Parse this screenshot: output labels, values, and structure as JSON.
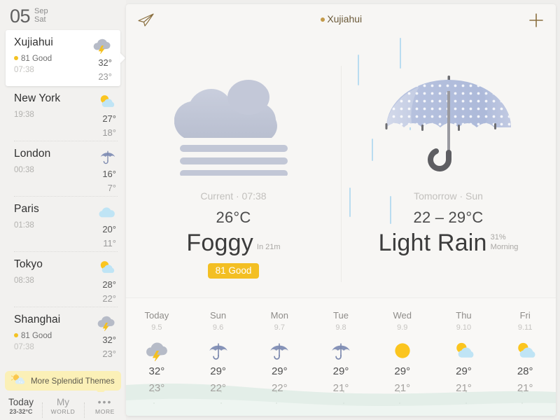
{
  "sidebar": {
    "date": {
      "day": "05",
      "month": "Sep",
      "weekday": "Sat"
    },
    "cities": [
      {
        "name": "Xujiahui",
        "aqi": "81 Good",
        "time": "07:38",
        "high": "32°",
        "low": "23°",
        "icon": "thunder-cloud-icon",
        "selected": true
      },
      {
        "name": "New York",
        "aqi": "",
        "time": "19:38",
        "high": "27°",
        "low": "18°",
        "icon": "sun-cloud-icon",
        "selected": false
      },
      {
        "name": "London",
        "aqi": "",
        "time": "00:38",
        "high": "16°",
        "low": "7°",
        "icon": "umbrella-icon",
        "selected": false
      },
      {
        "name": "Paris",
        "aqi": "",
        "time": "01:38",
        "high": "20°",
        "low": "11°",
        "icon": "cloud-icon",
        "selected": false
      },
      {
        "name": "Tokyo",
        "aqi": "",
        "time": "08:38",
        "high": "28°",
        "low": "22°",
        "icon": "sun-cloud-icon",
        "selected": false
      },
      {
        "name": "Shanghai",
        "aqi": "81 Good",
        "time": "07:38",
        "high": "32°",
        "low": "23°",
        "icon": "thunder-cloud-icon",
        "selected": false
      }
    ],
    "themes_button": "More Splendid Themes",
    "nav": [
      {
        "primary": "Today",
        "secondary": "23-32°C",
        "active": true
      },
      {
        "primary": "My",
        "secondary": "WORLD",
        "active": false
      },
      {
        "primary": "•••",
        "secondary": "MORE",
        "active": false
      }
    ]
  },
  "header": {
    "title": "Xujiahui",
    "share_icon": "paper-plane-icon",
    "add_icon": "plus-icon",
    "location_icon": "location-pin-icon"
  },
  "current": {
    "when": "Current · 07:38",
    "temperature": "26°C",
    "condition": "Foggy",
    "note": "In 21m",
    "aqi_badge": "81 Good",
    "icon": "fog-icon"
  },
  "tomorrow": {
    "when": "Tomorrow · Sun",
    "temperature": "22 – 29°C",
    "condition": "Light Rain",
    "note_pct": "31%",
    "note_time": "Morning",
    "icon": "umbrella-icon"
  },
  "forecast": [
    {
      "day": "Today",
      "date": "9.5",
      "icon": "thunder-cloud-icon",
      "high": "32°",
      "low": "23°"
    },
    {
      "day": "Sun",
      "date": "9.6",
      "icon": "umbrella-icon",
      "high": "29°",
      "low": "22°"
    },
    {
      "day": "Mon",
      "date": "9.7",
      "icon": "umbrella-icon",
      "high": "29°",
      "low": "22°"
    },
    {
      "day": "Tue",
      "date": "9.8",
      "icon": "umbrella-icon",
      "high": "29°",
      "low": "21°"
    },
    {
      "day": "Wed",
      "date": "9.9",
      "icon": "sun-icon",
      "high": "29°",
      "low": "21°"
    },
    {
      "day": "Thu",
      "date": "9.10",
      "icon": "sun-cloud-icon",
      "high": "29°",
      "low": "21°"
    },
    {
      "day": "Fri",
      "date": "9.11",
      "icon": "sun-cloud-icon",
      "high": "28°",
      "low": "21°"
    }
  ],
  "colors": {
    "accent_yellow": "#f3bf23",
    "theme_pill": "#fbf0b7",
    "title_brown": "#6b5a39",
    "rain_blue": "#b9dcf0",
    "panel_bg": "#f7f6f4",
    "sidebar_bg": "#f2f1ef"
  }
}
